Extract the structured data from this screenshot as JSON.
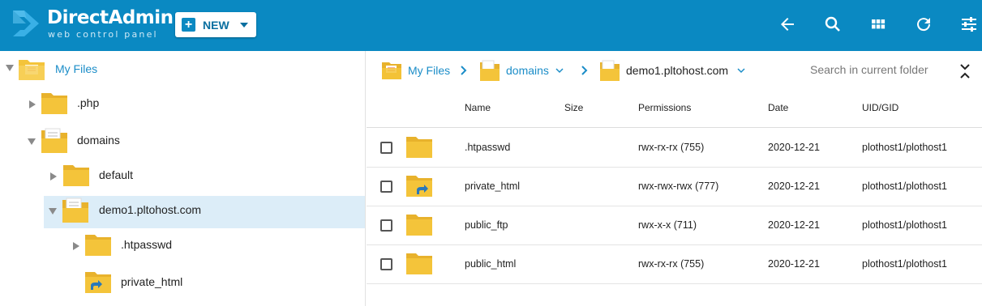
{
  "header": {
    "brand": "DirectAdmin",
    "brand_sub": "web control panel",
    "new_label": "NEW",
    "tools": [
      "back-icon",
      "search-icon",
      "grid-view-icon",
      "refresh-icon",
      "settings-sliders-icon"
    ]
  },
  "tree": {
    "root": "My Files",
    "items": [
      {
        "label": ".php"
      },
      {
        "label": "domains"
      },
      {
        "label": "default"
      },
      {
        "label": "demo1.pltohost.com"
      },
      {
        "label": ".htpasswd"
      },
      {
        "label": "private_html"
      }
    ]
  },
  "breadcrumb": {
    "items": [
      "My Files",
      "domains",
      "demo1.pltohost.com"
    ],
    "search_placeholder": "Search in current folder"
  },
  "table": {
    "columns": [
      "Name",
      "Size",
      "Permissions",
      "Date",
      "UID/GID"
    ],
    "rows": [
      {
        "name": ".htpasswd",
        "size": "",
        "permissions": "rwx-rx-rx (755)",
        "date": "2020-12-21",
        "owner": "plothost1/plothost1"
      },
      {
        "name": "private_html",
        "size": "",
        "permissions": "rwx-rwx-rwx (777)",
        "date": "2020-12-21",
        "owner": "plothost1/plothost1"
      },
      {
        "name": "public_ftp",
        "size": "",
        "permissions": "rwx-x-x (711)",
        "date": "2020-12-21",
        "owner": "plothost1/plothost1"
      },
      {
        "name": "public_html",
        "size": "",
        "permissions": "rwx-rx-rx (755)",
        "date": "2020-12-21",
        "owner": "plothost1/plothost1"
      }
    ]
  },
  "colors": {
    "header_bg": "#0a89c2",
    "link": "#1b8dc8",
    "folder": "#f4c43a",
    "selected_bg": "#dcedf8"
  }
}
